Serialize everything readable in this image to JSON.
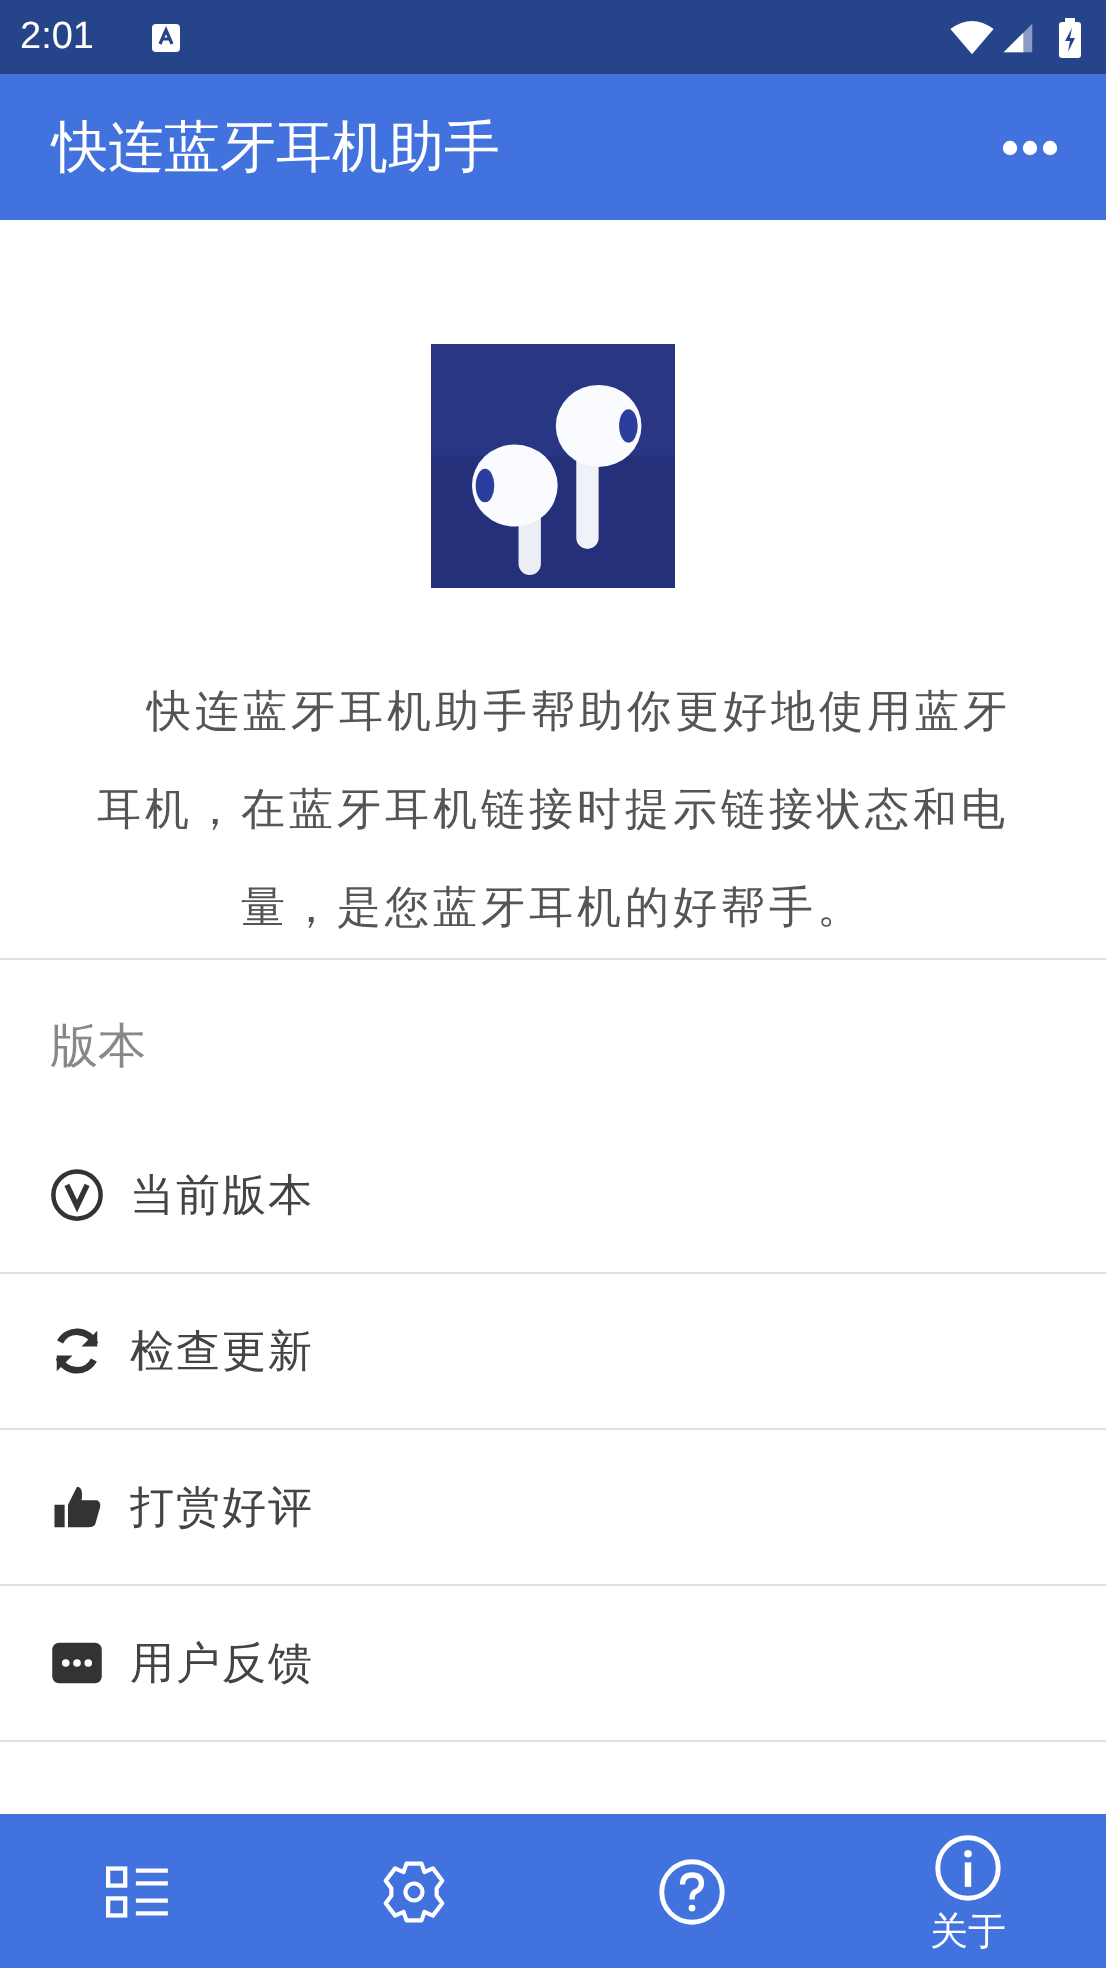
{
  "status_bar": {
    "time": "2:01"
  },
  "app_bar": {
    "title": "快连蓝牙耳机助手"
  },
  "about": {
    "description": "快连蓝牙耳机助手帮助你更好地使用蓝牙耳机，在蓝牙耳机链接时提示链接状态和电量，是您蓝牙耳机的好帮手。"
  },
  "section": {
    "title": "版本",
    "items": [
      {
        "kind": "version",
        "label": "当前版本"
      },
      {
        "kind": "update",
        "label": "检查更新"
      },
      {
        "kind": "like",
        "label": "打赏好评"
      },
      {
        "kind": "feedback",
        "label": "用户反馈"
      }
    ]
  },
  "bottom_nav": [
    {
      "kind": "list",
      "selected": false
    },
    {
      "kind": "settings",
      "selected": false
    },
    {
      "kind": "help",
      "selected": false
    },
    {
      "kind": "info",
      "label": "关于",
      "selected": true
    }
  ]
}
